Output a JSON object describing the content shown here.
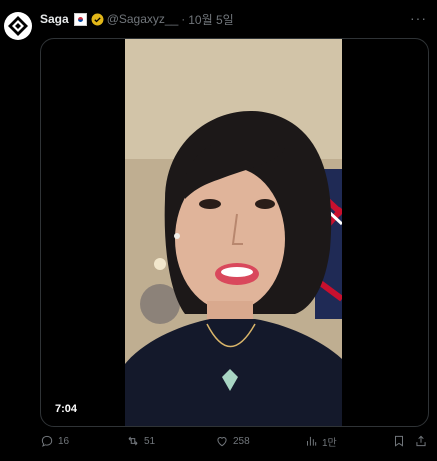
{
  "tweet": {
    "author_name": "Saga",
    "handle": "@Sagaxyz__",
    "separator": "·",
    "date": "10월 5일",
    "more_label": "···"
  },
  "media": {
    "duration": "7:04"
  },
  "actions": {
    "replies": "16",
    "retweets": "51",
    "likes": "258",
    "views": "1만"
  },
  "colors": {
    "background": "#000000",
    "text": "#e7e9ea",
    "muted": "#71767b",
    "verified": "#e2b719",
    "border": "#2f3336"
  }
}
